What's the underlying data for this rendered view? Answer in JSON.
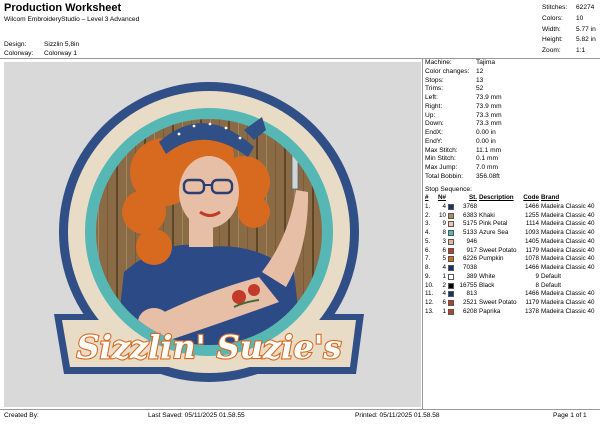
{
  "header": {
    "title": "Production Worksheet",
    "subtitle": "Wilcom EmbroideryStudio – Level 3 Advanced",
    "design_label": "Design:",
    "design_value": "Sizzlin 5,8in",
    "colorway_label": "Colorway:",
    "colorway_value": "Colorway 1"
  },
  "stats": [
    {
      "label": "Stitches:",
      "value": "62274"
    },
    {
      "label": "Colors:",
      "value": "10"
    },
    {
      "label": "Width:",
      "value": "5.77 in"
    },
    {
      "label": "Height:",
      "value": "5.82 in"
    },
    {
      "label": "Zoom:",
      "value": "1:1"
    }
  ],
  "machine_info": [
    {
      "label": "Machine:",
      "value": "Tajima"
    },
    {
      "label": "Color changes:",
      "value": "12"
    },
    {
      "label": "Stops:",
      "value": "13"
    },
    {
      "label": "Trims:",
      "value": "52"
    },
    {
      "label": "Left:",
      "value": "73.9 mm"
    },
    {
      "label": "Right:",
      "value": "73.9 mm"
    },
    {
      "label": "Up:",
      "value": "73.3 mm"
    },
    {
      "label": "Down:",
      "value": "73.3 mm"
    },
    {
      "label": "EndX:",
      "value": "0.00 in"
    },
    {
      "label": "EndY:",
      "value": "0.00 in"
    },
    {
      "label": "Max Stitch:",
      "value": "11.1 mm"
    },
    {
      "label": "Min Stitch:",
      "value": "0.1 mm"
    },
    {
      "label": "Max Jump:",
      "value": "7.0 mm"
    },
    {
      "label": "Total Bobbin:",
      "value": "356.08ft"
    }
  ],
  "stop_sequence": {
    "title": "Stop Sequence:",
    "headers": [
      "#",
      "N#",
      "",
      "St.",
      "Description",
      "Code",
      "Brand"
    ],
    "rows": [
      {
        "num": "1.",
        "n": "4",
        "color": "#1b2f6b",
        "st": "3768",
        "desc": "",
        "code": "1466",
        "brand": "Madeira Classic 40"
      },
      {
        "num": "2.",
        "n": "10",
        "color": "#b58b5b",
        "st": "6383",
        "desc": "Khaki",
        "code": "1255",
        "brand": "Madeira Classic 40"
      },
      {
        "num": "3.",
        "n": "9",
        "color": "#f2c4b0",
        "st": "5175",
        "desc": "Pink Petal",
        "code": "1114",
        "brand": "Madeira Classic 40"
      },
      {
        "num": "4.",
        "n": "8",
        "color": "#56b7b5",
        "st": "5133",
        "desc": "Azure Sea",
        "code": "1093",
        "brand": "Madeira Classic 40"
      },
      {
        "num": "5.",
        "n": "3",
        "color": "#e0b89a",
        "st": "946",
        "desc": "",
        "code": "1405",
        "brand": "Madeira Classic 40"
      },
      {
        "num": "6.",
        "n": "6",
        "color": "#c23a2a",
        "st": "917",
        "desc": "Sweet Potato",
        "code": "1179",
        "brand": "Madeira Classic 40"
      },
      {
        "num": "7.",
        "n": "5",
        "color": "#d86a1f",
        "st": "6226",
        "desc": "Pumpkin",
        "code": "1078",
        "brand": "Madeira Classic 40"
      },
      {
        "num": "8.",
        "n": "4",
        "color": "#1b2f6b",
        "st": "7038",
        "desc": "",
        "code": "1466",
        "brand": "Madeira Classic 40"
      },
      {
        "num": "9.",
        "n": "1",
        "color": "#ffffff",
        "st": "389",
        "desc": "White",
        "code": "9",
        "brand": "Default"
      },
      {
        "num": "10.",
        "n": "2",
        "color": "#000000",
        "st": "16755",
        "desc": "Black",
        "code": "8",
        "brand": "Default"
      },
      {
        "num": "11.",
        "n": "4",
        "color": "#1b2f6b",
        "st": "813",
        "desc": "",
        "code": "1466",
        "brand": "Madeira Classic 40"
      },
      {
        "num": "12.",
        "n": "6",
        "color": "#c23a2a",
        "st": "2521",
        "desc": "Sweet Potato",
        "code": "1179",
        "brand": "Madeira Classic 40"
      },
      {
        "num": "13.",
        "n": "1",
        "color": "#b8412c",
        "st": "6208",
        "desc": "Paprika",
        "code": "1378",
        "brand": "Madeira Classic 40"
      }
    ]
  },
  "design": {
    "text": "Sizzlin' Suzie's",
    "colors": {
      "border": "#2f4f86",
      "ring": "#56b7b5",
      "wood": "#8a6b45",
      "hair": "#d86a1f",
      "shirt": "#2c4a86",
      "skin": "#e6bfa6",
      "text_fill": "#ffffff",
      "text_outline": "#d86a1f"
    }
  },
  "footer": {
    "created_by": "Created By:",
    "last_saved": "Last Saved: 05/11/2025 01.58.55",
    "printed": "Printed: 05/11/2025 01.58.58",
    "page": "Page 1 of 1"
  }
}
